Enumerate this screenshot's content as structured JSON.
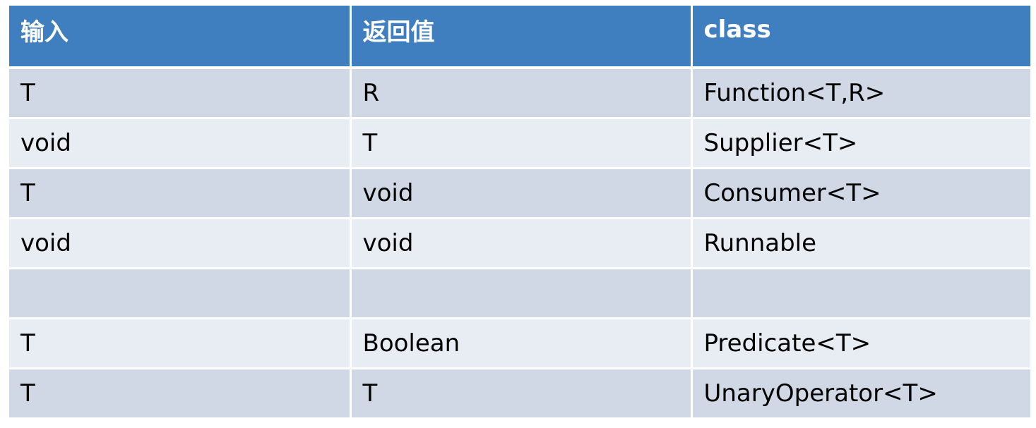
{
  "table": {
    "headers": [
      "输入",
      "返回值",
      "class"
    ],
    "rows": [
      [
        "T",
        "R",
        "Function<T,R>"
      ],
      [
        "void",
        "T",
        "Supplier<T>"
      ],
      [
        "T",
        "void",
        "Consumer<T>"
      ],
      [
        "void",
        "void",
        "Runnable"
      ],
      [
        "",
        "",
        ""
      ],
      [
        "T",
        "Boolean",
        "Predicate<T>"
      ],
      [
        "T",
        "T",
        "UnaryOperator<T>"
      ]
    ]
  },
  "colors": {
    "header_bg": "#3f7fc0",
    "row_odd_bg": "#d0d8e6",
    "row_even_bg": "#e8ecf3"
  }
}
